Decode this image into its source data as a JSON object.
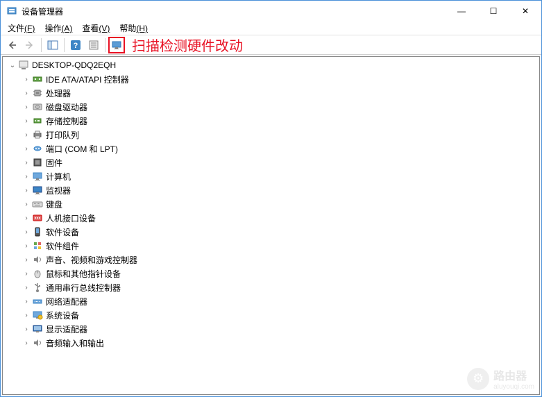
{
  "window": {
    "title": "设备管理器"
  },
  "win_controls": {
    "min_glyph": "—",
    "max_glyph": "☐",
    "close_glyph": "✕"
  },
  "menu": {
    "file": {
      "label": "文件",
      "accel": "(F)"
    },
    "action": {
      "label": "操作",
      "accel": "(A)"
    },
    "view": {
      "label": "查看",
      "accel": "(V)"
    },
    "help": {
      "label": "帮助",
      "accel": "(H)"
    }
  },
  "toolbar": {
    "annotation": "扫描检测硬件改动",
    "highlight_color": "#e81123"
  },
  "tree": {
    "root": {
      "label": "DESKTOP-QDQ2EQH",
      "expanded": true
    },
    "items": [
      {
        "label": "IDE ATA/ATAPI 控制器",
        "icon": "controller"
      },
      {
        "label": "处理器",
        "icon": "cpu"
      },
      {
        "label": "磁盘驱动器",
        "icon": "disk"
      },
      {
        "label": "存储控制器",
        "icon": "storage"
      },
      {
        "label": "打印队列",
        "icon": "printer"
      },
      {
        "label": "端口 (COM 和 LPT)",
        "icon": "port"
      },
      {
        "label": "固件",
        "icon": "firmware"
      },
      {
        "label": "计算机",
        "icon": "computer"
      },
      {
        "label": "监视器",
        "icon": "monitor"
      },
      {
        "label": "键盘",
        "icon": "keyboard"
      },
      {
        "label": "人机接口设备",
        "icon": "hid"
      },
      {
        "label": "软件设备",
        "icon": "software"
      },
      {
        "label": "软件组件",
        "icon": "component"
      },
      {
        "label": "声音、视频和游戏控制器",
        "icon": "sound"
      },
      {
        "label": "鼠标和其他指针设备",
        "icon": "mouse"
      },
      {
        "label": "通用串行总线控制器",
        "icon": "usb"
      },
      {
        "label": "网络适配器",
        "icon": "network"
      },
      {
        "label": "系统设备",
        "icon": "system"
      },
      {
        "label": "显示适配器",
        "icon": "display"
      },
      {
        "label": "音频输入和输出",
        "icon": "audio"
      }
    ]
  },
  "watermark": {
    "title": "路由器",
    "url": "aluyouqi.com"
  }
}
